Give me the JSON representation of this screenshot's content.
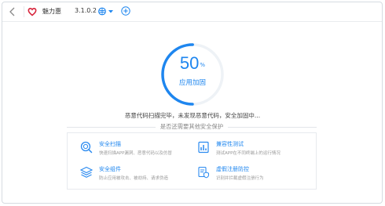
{
  "app": {
    "name": "魅力惠",
    "version": "3.1.0.2",
    "platform_icon": "android-icon",
    "brand_color": "#d7263d"
  },
  "progress": {
    "percent": 50,
    "symbol": "%",
    "label": "应用加固",
    "fraction": 0.5,
    "color": "#1e86ef"
  },
  "status_text": "恶意代码扫描完毕，未发现恶意代码，安全加固中...",
  "prompt": "是否还需要其他安全保护",
  "features": [
    {
      "title": "安全扫描",
      "desc": "快速扫描APP漏洞、恶意代码以及仿冒",
      "icon": "scan-icon"
    },
    {
      "title": "兼容性测试",
      "desc": "测试APP在不同终端上的运行情况",
      "icon": "compat-icon"
    },
    {
      "title": "安全组件",
      "desc": "防止应用被攻击、被劫持、请求伪造",
      "icon": "layers-icon"
    },
    {
      "title": "虚假注册防控",
      "desc": "识别并拦截虚假注册行为",
      "icon": "shield-icon"
    }
  ]
}
